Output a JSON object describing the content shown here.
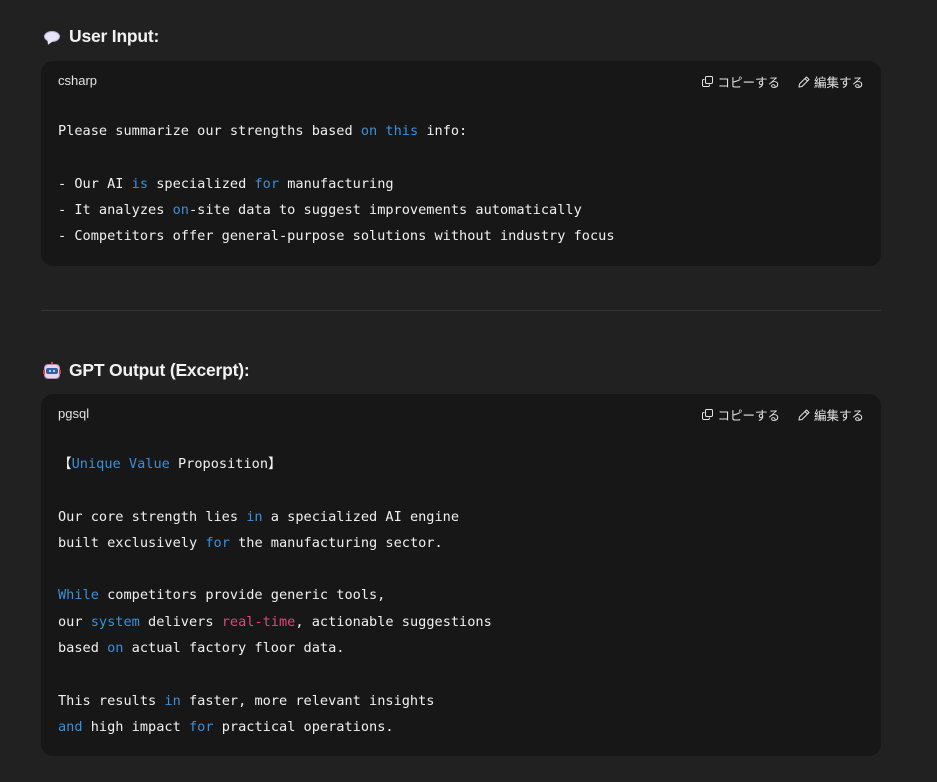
{
  "input_section": {
    "heading": "User Input:",
    "icon": "speech-balloon-icon",
    "block": {
      "language": "csharp",
      "copy_label": "コピーする",
      "edit_label": "編集する",
      "lines": [
        [
          {
            "t": "Please summarize our strengths based "
          },
          {
            "t": "on",
            "c": "kw"
          },
          {
            "t": " "
          },
          {
            "t": "this",
            "c": "kw"
          },
          {
            "t": " info:"
          }
        ],
        [],
        [
          {
            "t": "- Our AI "
          },
          {
            "t": "is",
            "c": "kw"
          },
          {
            "t": " specialized "
          },
          {
            "t": "for",
            "c": "kw"
          },
          {
            "t": " manufacturing"
          }
        ],
        [
          {
            "t": "- It analyzes "
          },
          {
            "t": "on",
            "c": "kw"
          },
          {
            "t": "-site data to suggest improvements automatically"
          }
        ],
        [
          {
            "t": "- Competitors offer general-purpose solutions without industry focus"
          }
        ]
      ]
    }
  },
  "output_section": {
    "heading": "GPT Output (Excerpt):",
    "icon": "robot-icon",
    "block": {
      "language": "pgsql",
      "copy_label": "コピーする",
      "edit_label": "編集する",
      "lines": [
        [
          {
            "t": "【"
          },
          {
            "t": "Unique",
            "c": "kw"
          },
          {
            "t": " "
          },
          {
            "t": "Value",
            "c": "kw"
          },
          {
            "t": " Proposition】"
          }
        ],
        [],
        [
          {
            "t": "Our core strength lies "
          },
          {
            "t": "in",
            "c": "kw"
          },
          {
            "t": " a specialized AI engine"
          }
        ],
        [
          {
            "t": "built exclusively "
          },
          {
            "t": "for",
            "c": "kw"
          },
          {
            "t": " the manufacturing sector."
          }
        ],
        [],
        [
          {
            "t": "While",
            "c": "kw"
          },
          {
            "t": " competitors provide generic tools,"
          }
        ],
        [
          {
            "t": "our "
          },
          {
            "t": "system",
            "c": "kw"
          },
          {
            "t": " delivers "
          },
          {
            "t": "real-time",
            "c": "str"
          },
          {
            "t": ", actionable suggestions"
          }
        ],
        [
          {
            "t": "based "
          },
          {
            "t": "on",
            "c": "kw"
          },
          {
            "t": " actual factory floor data."
          }
        ],
        [],
        [
          {
            "t": "This results "
          },
          {
            "t": "in",
            "c": "kw"
          },
          {
            "t": " faster, more relevant insights"
          }
        ],
        [
          {
            "t": "and",
            "c": "kw"
          },
          {
            "t": " high impact "
          },
          {
            "t": "for",
            "c": "kw"
          },
          {
            "t": " practical operations."
          }
        ]
      ]
    }
  },
  "colors": {
    "background": "#212121",
    "code_background": "#171717",
    "keyword": "#3b8fd9",
    "string": "#e0467c",
    "text": "#f0f0f0"
  }
}
